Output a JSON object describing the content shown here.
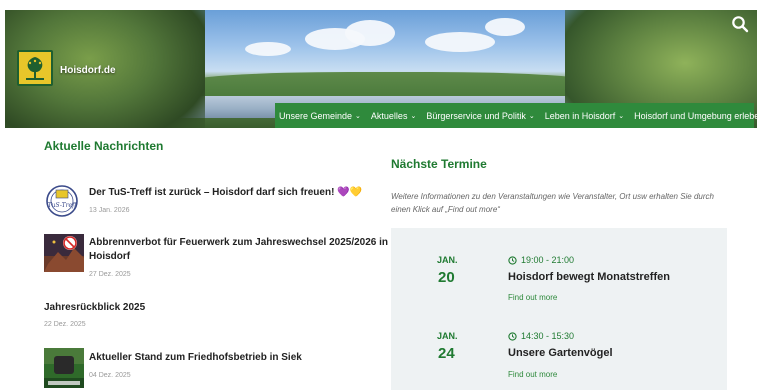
{
  "header": {
    "site_name": "Hoisdorf.de",
    "search_icon": "search-icon",
    "nav": [
      {
        "label": "Unsere Gemeinde"
      },
      {
        "label": "Aktuelles"
      },
      {
        "label": "Bürgerservice und Politik"
      },
      {
        "label": "Leben in Hoisdorf"
      },
      {
        "label": "Hoisdorf und Umgebung erleben"
      }
    ],
    "nav_color": "#2f8a3c"
  },
  "news": {
    "title": "Aktuelle Nachrichten",
    "items": [
      {
        "headline": "Der TuS-Treff ist zurück – Hoisdorf darf sich freuen! 💜💛",
        "date": "13 Jan. 2026",
        "thumb": "tus-treff-logo"
      },
      {
        "headline_line1": "Abbrennverbot für Feuerwerk zum Jahreswechsel 2025/2026 in",
        "headline_line2": "Hoisdorf",
        "date": "27 Dez. 2025",
        "thumb": "fireworks-ban-image"
      },
      {
        "headline": "Jahresrückblick 2025",
        "date": "22 Dez. 2025"
      },
      {
        "headline": "Aktueller Stand zum Friedhofsbetrieb in Siek",
        "date": "04 Dez. 2025",
        "thumb": "cemetery-image"
      }
    ]
  },
  "termine": {
    "title": "Nächste Termine",
    "intro": "Weitere Informationen zu den Veranstaltungen wie Veranstalter, Ort usw erhalten Sie durch einen Klick auf „Find out more“",
    "events": [
      {
        "month": "JAN.",
        "day": "20",
        "time": "19:00 - 21:00",
        "title": "Hoisdorf bewegt Monatstreffen",
        "link": "Find out more"
      },
      {
        "month": "JAN.",
        "day": "24",
        "time": "14:30 - 15:30",
        "title": "Unsere Gartenvögel",
        "link": "Find out more"
      }
    ],
    "accent_color": "#1f7a31"
  }
}
